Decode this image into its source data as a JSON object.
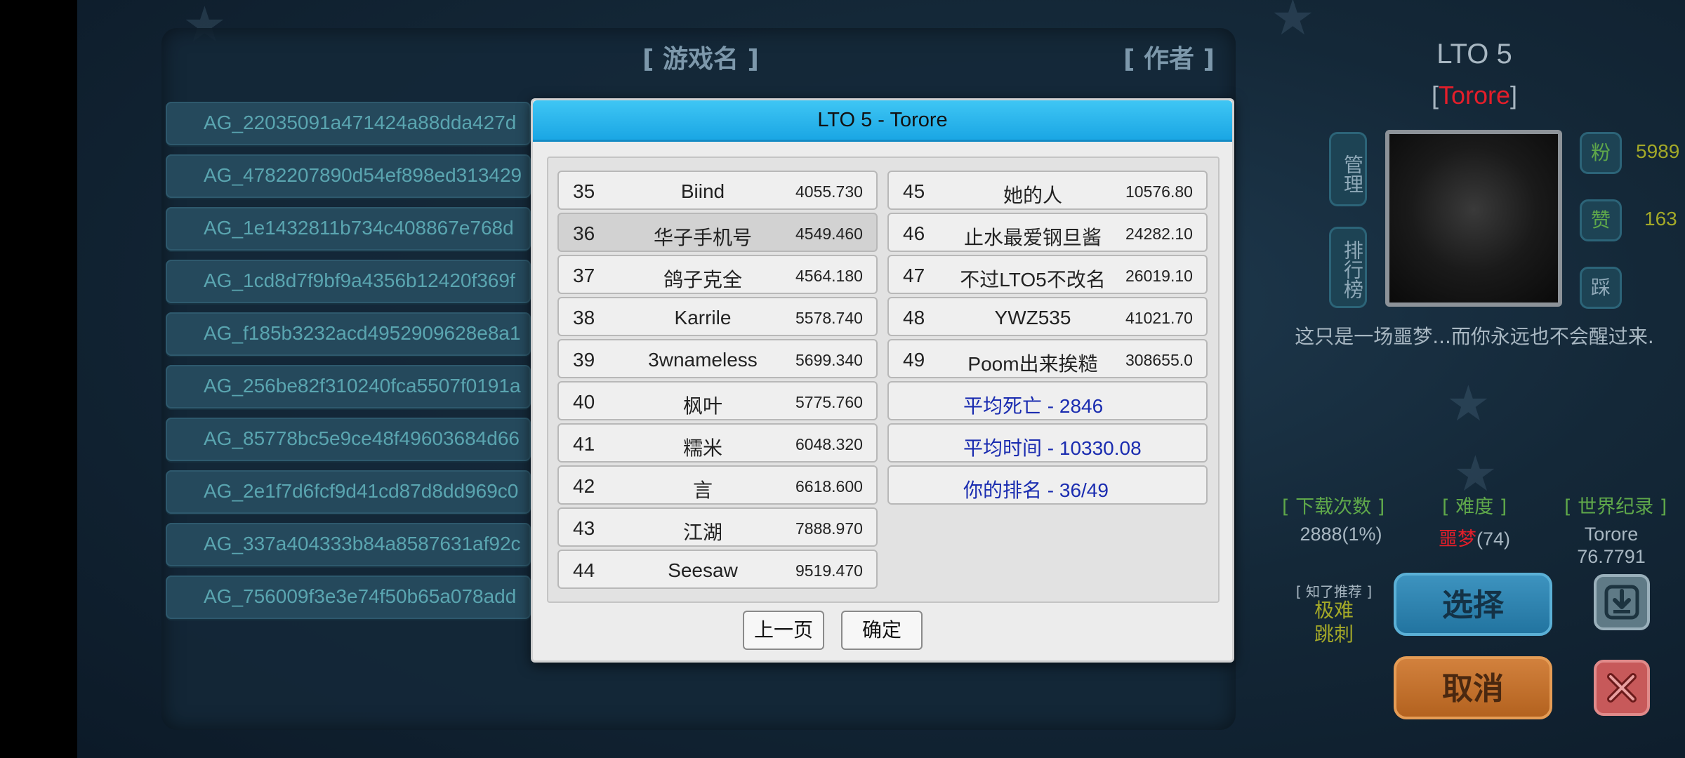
{
  "list": {
    "header_name": "[ 游戏名 ]",
    "header_author": "[ 作者 ]",
    "games": [
      "AG_22035091a471424a88dda427d",
      "AG_4782207890d54ef898ed313429",
      "AG_1e1432811b734c408867e768d",
      "AG_1cd8d7f9bf9a4356b12420f369f",
      "AG_f185b3232acd4952909628e8a1",
      "AG_256be82f310240fca5507f0191a",
      "AG_85778bc5e9ce48f49603684d66",
      "AG_2e1f7d6fcf9d41cd87d8dd969c0",
      "AG_337a404333b84a8587631af92c",
      "AG_756009f3e3e74f50b65a078add"
    ]
  },
  "dialog": {
    "title": "LTO 5 - Torore",
    "left_column": [
      {
        "rank": "35",
        "name": "Biind",
        "time": "4055.730"
      },
      {
        "rank": "36",
        "name": "华子手机号",
        "time": "4549.460"
      },
      {
        "rank": "37",
        "name": "鸽子克全",
        "time": "4564.180"
      },
      {
        "rank": "38",
        "name": "Karrile",
        "time": "5578.740"
      },
      {
        "rank": "39",
        "name": "3wnameless",
        "time": "5699.340"
      },
      {
        "rank": "40",
        "name": "枫叶",
        "time": "5775.760"
      },
      {
        "rank": "41",
        "name": "糯米",
        "time": "6048.320"
      },
      {
        "rank": "42",
        "name": "言",
        "time": "6618.600"
      },
      {
        "rank": "43",
        "name": "江湖",
        "time": "7888.970"
      },
      {
        "rank": "44",
        "name": "Seesaw",
        "time": "9519.470"
      }
    ],
    "right_column": [
      {
        "rank": "45",
        "name": "她的人",
        "time": "10576.80"
      },
      {
        "rank": "46",
        "name": "止水最爱钢旦酱",
        "time": "24282.10"
      },
      {
        "rank": "47",
        "name": "不过LTO5不改名",
        "time": "26019.10"
      },
      {
        "rank": "48",
        "name": "YWZ535",
        "time": "41021.70"
      },
      {
        "rank": "49",
        "name": "Poom出来挨糙",
        "time": "308655.0"
      }
    ],
    "stats": {
      "avg_death": "平均死亡 - 2846",
      "avg_time": "平均时间 - 10330.08",
      "your_rank": "你的排名 - 36/49"
    },
    "prev_button": "上一页",
    "ok_button": "确定"
  },
  "info": {
    "title": "LTO 5",
    "author_open": "[",
    "author": "Torore",
    "author_close": "]",
    "manage_btn": "管理",
    "ranking_btn": "排行榜",
    "fans_label": "粉",
    "fans_count": "5989",
    "like_label": "赞",
    "like_count": "163",
    "dislike_label": "踩",
    "description": "这只是一场噩梦...而你永远也不会醒过来.",
    "downloads_header": "[ 下载次数 ]",
    "downloads_value": "2888(1%)",
    "difficulty_header": "[ 难度 ]",
    "difficulty_level": "噩梦",
    "difficulty_value": "(74)",
    "record_header": "[ 世界纪录 ]",
    "record_holder": "Torore",
    "record_time": "76.7791",
    "recommend_label": "[ 知了推荐 ]",
    "recommend_line1": "极难",
    "recommend_line2": "跳刺",
    "select_btn": "选择",
    "cancel_btn": "取消"
  },
  "colors": {
    "title_bar": "#1aa6e4",
    "stat_text": "#1a2cb0",
    "author_red": "#e41e2a",
    "olive": "#a4a928",
    "green_header": "#5fa84a"
  }
}
